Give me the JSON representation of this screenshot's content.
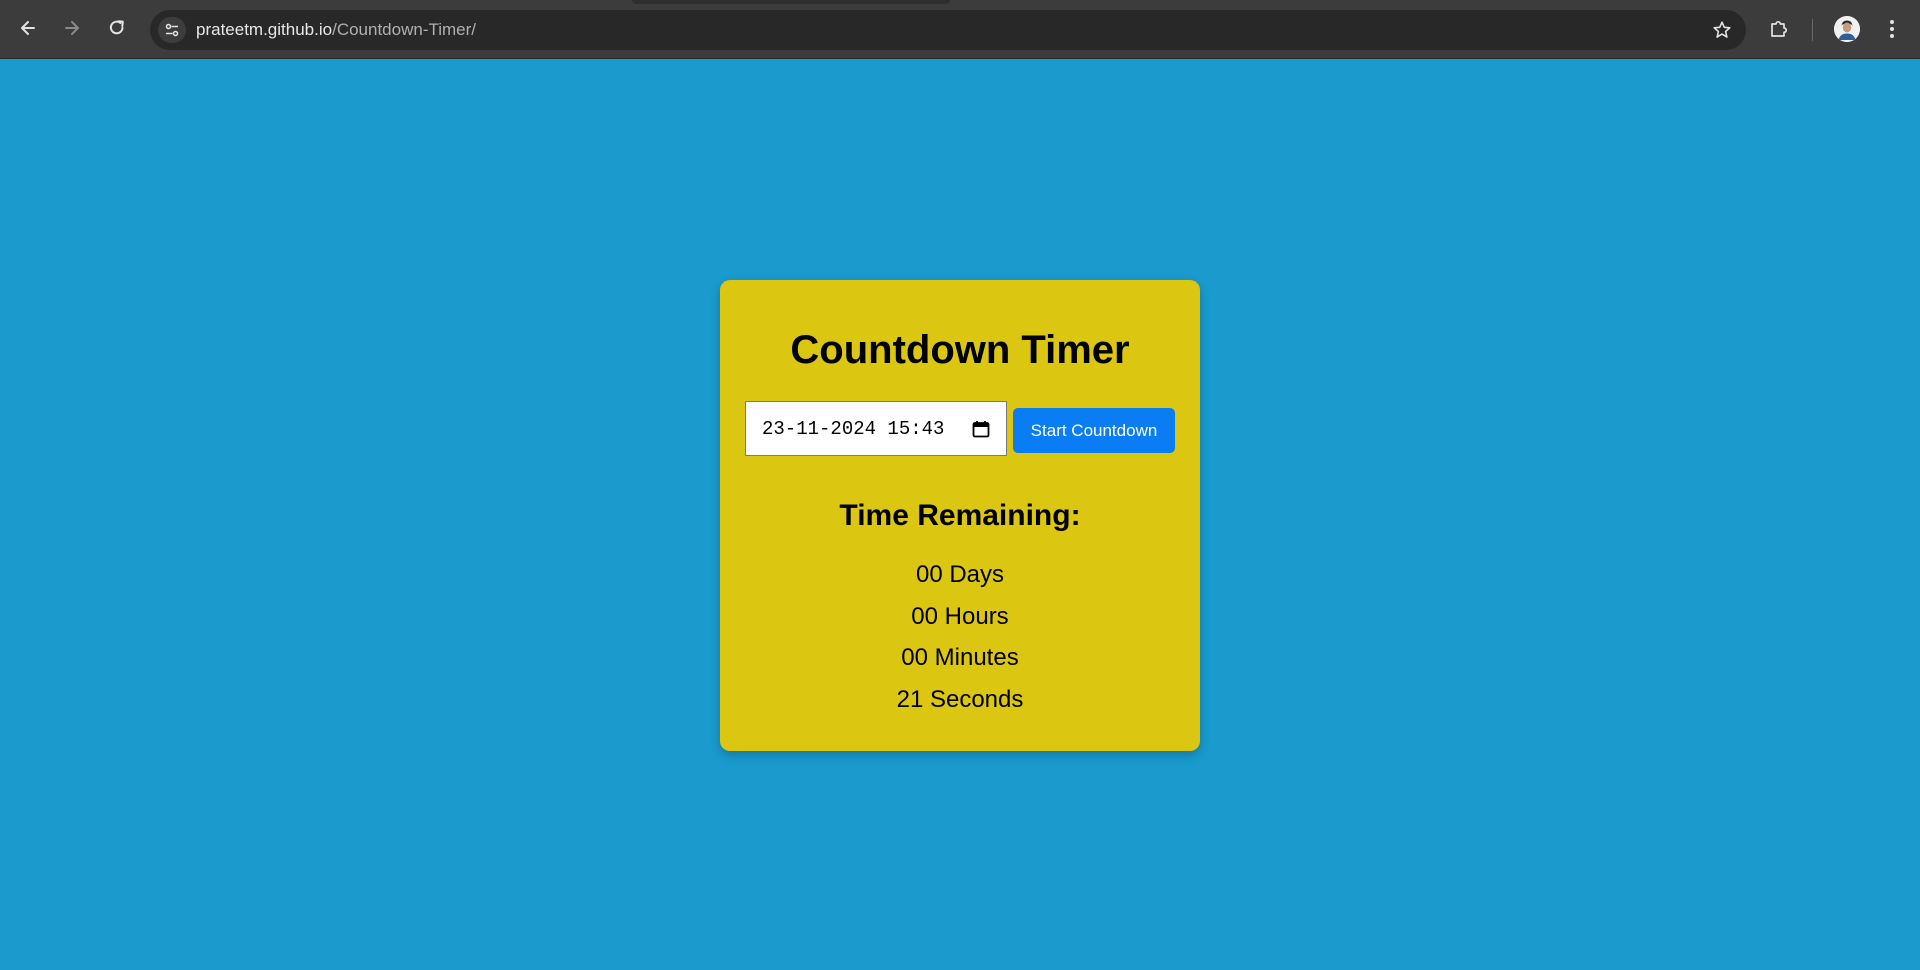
{
  "browser": {
    "url_host": "prateetm.github.io",
    "url_path": "/Countdown-Timer/",
    "icons": {
      "back": "arrow-left-icon",
      "forward": "arrow-right-icon",
      "reload": "reload-icon",
      "site_info": "tune-icon",
      "bookmark": "star-icon",
      "extensions": "puzzle-icon",
      "profile": "avatar",
      "menu": "kebab-menu-icon"
    }
  },
  "page": {
    "background_color": "#1a9acd",
    "card_color": "#dbc612",
    "title": "Countdown Timer",
    "datetime_input": {
      "value": "23-11-2024 15:43"
    },
    "start_button": {
      "label": "Start Countdown",
      "color": "#0a7cf4"
    },
    "remaining_heading": "Time Remaining:",
    "countdown": {
      "days": "00 Days",
      "hours": "00 Hours",
      "minutes": "00 Minutes",
      "seconds": "21 Seconds"
    }
  }
}
